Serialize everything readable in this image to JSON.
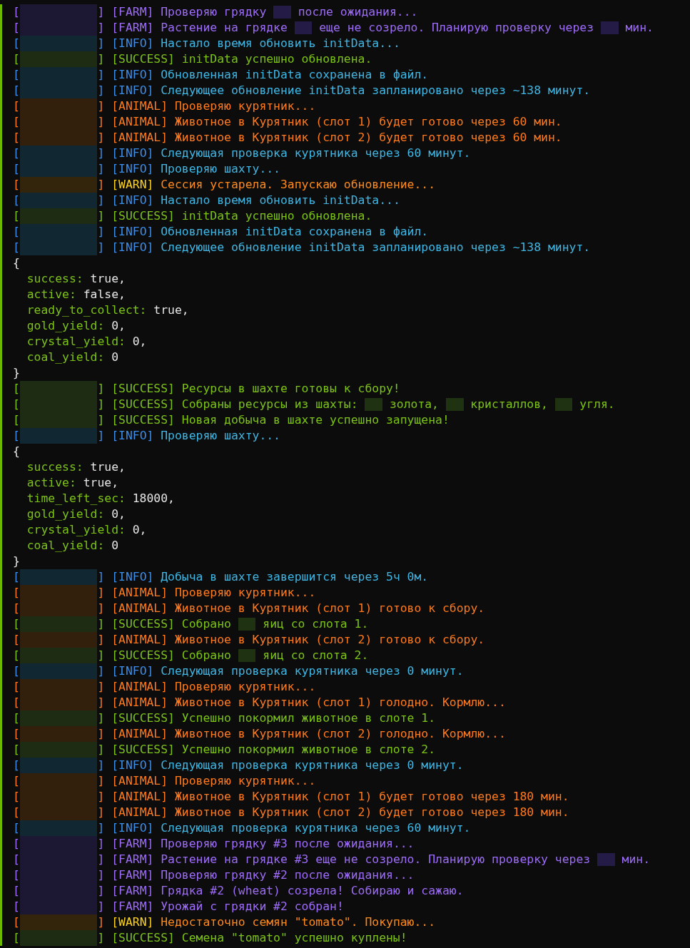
{
  "lines": [
    {
      "kind": "farm",
      "stamp": [
        "[",
        "]"
      ],
      "tag": "[FARM]",
      "segments": [
        "Проверяю грядку",
        "после ожидания..."
      ]
    },
    {
      "kind": "farm",
      "stamp": [
        "[",
        "]"
      ],
      "tag": "[FARM]",
      "segments": [
        "Растение на грядке",
        "еще не созрело. Планирую проверку через",
        "мин."
      ]
    },
    {
      "kind": "info",
      "stamp": [
        "[",
        "]"
      ],
      "tag": "[INFO]",
      "segments": [
        "Настало время обновить initData..."
      ]
    },
    {
      "kind": "success",
      "stamp": [
        "[",
        "]"
      ],
      "tag": "[SUCCESS]",
      "segments": [
        "initData успешно обновлена."
      ]
    },
    {
      "kind": "info",
      "stamp": [
        "[",
        "]"
      ],
      "tag": "[INFO]",
      "segments": [
        "Обновленная initData сохранена в файл."
      ]
    },
    {
      "kind": "info",
      "stamp": [
        "[",
        "]"
      ],
      "tag": "[INFO]",
      "segments": [
        "Следующее обновление initData запланировано через ~138 минут."
      ]
    },
    {
      "kind": "animal",
      "stamp": [
        "[",
        "]"
      ],
      "tag": "[ANIMAL]",
      "segments": [
        "Проверяю курятник..."
      ]
    },
    {
      "kind": "animal",
      "stamp": [
        "[",
        "]"
      ],
      "tag": "[ANIMAL]",
      "segments": [
        "Животное в Курятник (слот 1) будет готово через 60 мин."
      ]
    },
    {
      "kind": "animal",
      "stamp": [
        "[",
        "]"
      ],
      "tag": "[ANIMAL]",
      "segments": [
        "Животное в Курятник (слот 2) будет готово через 60 мин."
      ]
    },
    {
      "kind": "info",
      "stamp": [
        "[",
        "]"
      ],
      "tag": "[INFO]",
      "segments": [
        "Следующая проверка курятника через 60 минут."
      ]
    },
    {
      "kind": "info",
      "stamp": [
        "[",
        "]"
      ],
      "tag": "[INFO]",
      "segments": [
        "Проверяю шахту..."
      ]
    },
    {
      "kind": "warn",
      "stamp": [
        "[",
        "]"
      ],
      "tag": "[WARN]",
      "segments": [
        "Сессия устарела. Запускаю обновление..."
      ]
    },
    {
      "kind": "info",
      "stamp": [
        "[",
        "]"
      ],
      "tag": "[INFO]",
      "segments": [
        "Настало время обновить initData..."
      ]
    },
    {
      "kind": "success",
      "stamp": [
        "[",
        "]"
      ],
      "tag": "[SUCCESS]",
      "segments": [
        "initData успешно обновлена."
      ]
    },
    {
      "kind": "info",
      "stamp": [
        "[",
        "]"
      ],
      "tag": "[INFO]",
      "segments": [
        "Обновленная initData сохранена в файл."
      ]
    },
    {
      "kind": "info",
      "stamp": [
        "[",
        "]"
      ],
      "tag": "[INFO]",
      "segments": [
        "Следующее обновление initData запланировано через ~138 минут."
      ]
    },
    {
      "kind": "brace",
      "text": "{"
    },
    {
      "kind": "field",
      "key": "success:",
      "value": "true,"
    },
    {
      "kind": "field",
      "key": "active:",
      "value": "false,"
    },
    {
      "kind": "field",
      "key": "ready_to_collect:",
      "value": "true,"
    },
    {
      "kind": "field",
      "key": "gold_yield:",
      "value": "0,"
    },
    {
      "kind": "field",
      "key": "crystal_yield:",
      "value": "0,"
    },
    {
      "kind": "field",
      "key": "coal_yield:",
      "value": "0"
    },
    {
      "kind": "brace",
      "text": "}"
    },
    {
      "kind": "success",
      "stamp": [
        "[",
        "]"
      ],
      "tag": "[SUCCESS]",
      "segments": [
        "Ресурсы в шахте готовы к сбору!"
      ]
    },
    {
      "kind": "success",
      "stamp": [
        "[",
        "]"
      ],
      "tag": "[SUCCESS]",
      "segments": [
        "Собраны ресурсы из шахты:",
        "золота,",
        "кристаллов,",
        "угля."
      ]
    },
    {
      "kind": "success",
      "stamp": [
        "[",
        "]"
      ],
      "tag": "[SUCCESS]",
      "segments": [
        "Новая добыча в шахте успешно запущена!"
      ]
    },
    {
      "kind": "info",
      "stamp": [
        "[",
        "]"
      ],
      "tag": "[INFO]",
      "segments": [
        "Проверяю шахту..."
      ]
    },
    {
      "kind": "brace",
      "text": "{"
    },
    {
      "kind": "field",
      "key": "success:",
      "value": "true,"
    },
    {
      "kind": "field",
      "key": "active:",
      "value": "true,"
    },
    {
      "kind": "field",
      "key": "time_left_sec:",
      "value": "18000,"
    },
    {
      "kind": "field",
      "key": "gold_yield:",
      "value": "0,"
    },
    {
      "kind": "field",
      "key": "crystal_yield:",
      "value": "0,"
    },
    {
      "kind": "field",
      "key": "coal_yield:",
      "value": "0"
    },
    {
      "kind": "brace",
      "text": "}"
    },
    {
      "kind": "info",
      "stamp": [
        "[",
        "]"
      ],
      "tag": "[INFO]",
      "segments": [
        "Добыча в шахте завершится через 5ч 0м."
      ]
    },
    {
      "kind": "animal",
      "stamp": [
        "[",
        "]"
      ],
      "tag": "[ANIMAL]",
      "segments": [
        "Проверяю курятник..."
      ]
    },
    {
      "kind": "animal",
      "stamp": [
        "[",
        "]"
      ],
      "tag": "[ANIMAL]",
      "segments": [
        "Животное в Курятник (слот 1) готово к сбору."
      ]
    },
    {
      "kind": "success",
      "stamp": [
        "[",
        "]"
      ],
      "tag": "[SUCCESS]",
      "segments": [
        "Собрано",
        "яиц со слота 1."
      ]
    },
    {
      "kind": "animal",
      "stamp": [
        "[",
        "]"
      ],
      "tag": "[ANIMAL]",
      "segments": [
        "Животное в Курятник (слот 2) готово к сбору."
      ]
    },
    {
      "kind": "success",
      "stamp": [
        "[",
        "]"
      ],
      "tag": "[SUCCESS]",
      "segments": [
        "Собрано",
        "яиц со слота 2."
      ]
    },
    {
      "kind": "info",
      "stamp": [
        "[",
        "]"
      ],
      "tag": "[INFO]",
      "segments": [
        "Следующая проверка курятника через 0 минут."
      ]
    },
    {
      "kind": "animal",
      "stamp": [
        "[",
        "]"
      ],
      "tag": "[ANIMAL]",
      "segments": [
        "Проверяю курятник..."
      ]
    },
    {
      "kind": "animal",
      "stamp": [
        "[",
        "]"
      ],
      "tag": "[ANIMAL]",
      "segments": [
        "Животное в Курятник (слот 1) голодно. Кормлю..."
      ]
    },
    {
      "kind": "success",
      "stamp": [
        "[",
        "]"
      ],
      "tag": "[SUCCESS]",
      "segments": [
        "Успешно покормил животное в слоте 1."
      ]
    },
    {
      "kind": "animal",
      "stamp": [
        "[",
        "]"
      ],
      "tag": "[ANIMAL]",
      "segments": [
        "Животное в Курятник (слот 2) голодно. Кормлю..."
      ]
    },
    {
      "kind": "success",
      "stamp": [
        "[",
        "]"
      ],
      "tag": "[SUCCESS]",
      "segments": [
        "Успешно покормил животное в слоте 2."
      ]
    },
    {
      "kind": "info",
      "stamp": [
        "[",
        "]"
      ],
      "tag": "[INFO]",
      "segments": [
        "Следующая проверка курятника через 0 минут."
      ]
    },
    {
      "kind": "animal",
      "stamp": [
        "[",
        "]"
      ],
      "tag": "[ANIMAL]",
      "segments": [
        "Проверяю курятник..."
      ]
    },
    {
      "kind": "animal",
      "stamp": [
        "[",
        "]"
      ],
      "tag": "[ANIMAL]",
      "segments": [
        "Животное в Курятник (слот 1) будет готово через 180 мин."
      ]
    },
    {
      "kind": "animal",
      "stamp": [
        "[",
        "]"
      ],
      "tag": "[ANIMAL]",
      "segments": [
        "Животное в Курятник (слот 2) будет готово через 180 мин."
      ]
    },
    {
      "kind": "info",
      "stamp": [
        "[",
        "]"
      ],
      "tag": "[INFO]",
      "segments": [
        "Следующая проверка курятника через 60 минут."
      ]
    },
    {
      "kind": "farm",
      "stamp": [
        "[",
        "]"
      ],
      "tag": "[FARM]",
      "segments": [
        "Проверяю грядку #3 после ожидания..."
      ]
    },
    {
      "kind": "farm",
      "stamp": [
        "[",
        "]"
      ],
      "tag": "[FARM]",
      "segments": [
        "Растение на грядке #3 еще не созрело. Планирую проверку через",
        "мин."
      ]
    },
    {
      "kind": "farm",
      "stamp": [
        "[",
        "]"
      ],
      "tag": "[FARM]",
      "segments": [
        "Проверяю грядку #2 после ожидания..."
      ]
    },
    {
      "kind": "farm",
      "stamp": [
        "[",
        "]"
      ],
      "tag": "[FARM]",
      "segments": [
        "Грядка #2 (wheat) созрела! Собираю и сажаю."
      ]
    },
    {
      "kind": "farm",
      "stamp": [
        "[",
        "]"
      ],
      "tag": "[FARM]",
      "segments": [
        "Урожай с грядки #2 собран!"
      ]
    },
    {
      "kind": "warn",
      "stamp": [
        "[",
        "]"
      ],
      "tag": "[WARN]",
      "segments": [
        "Недостаточно семян \"tomato\". Покупаю..."
      ]
    },
    {
      "kind": "success",
      "stamp": [
        "[",
        "]"
      ],
      "tag": "[SUCCESS]",
      "segments": [
        "Семена \"tomato\" успешно куплены!"
      ]
    }
  ]
}
